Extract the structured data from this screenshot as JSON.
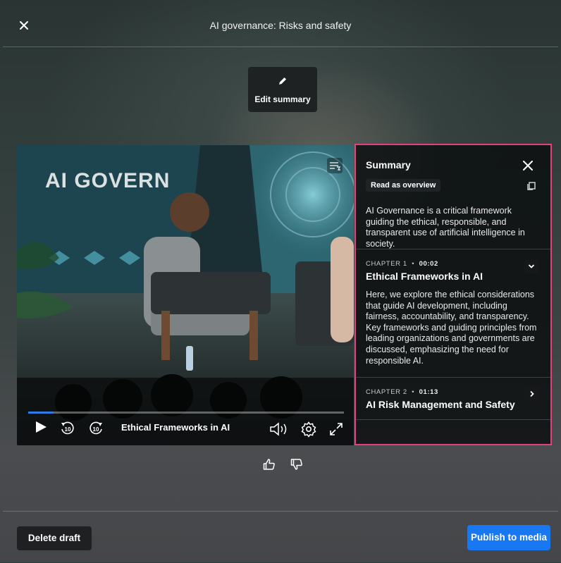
{
  "header": {
    "title": "AI governance: Risks and safety",
    "close_icon": "close-icon"
  },
  "edit_summary": {
    "label": "Edit summary",
    "icon": "pencil-icon"
  },
  "video": {
    "now_playing_chapter": "Ethical Frameworks in AI",
    "stage_sign_text": "AI GOVERN",
    "progress_fraction": 0.08,
    "controls": [
      "play-icon",
      "rewind-10-icon",
      "forward-10-icon",
      "volume-icon",
      "settings-gear-icon",
      "fullscreen-icon",
      "summary-toggle-icon"
    ]
  },
  "summary": {
    "heading": "Summary",
    "overview_badge": "Read as overview",
    "overview_text": "AI Governance is a critical framework guiding the ethical, responsible, and transparent use of artificial intelligence in society.",
    "chapters": [
      {
        "label": "CHAPTER 1",
        "time": "00:02",
        "title": "Ethical Frameworks in AI",
        "expanded": true,
        "body": "Here, we explore the ethical considerations that guide AI development, including fairness, accountability, and transparency. Key frameworks and guiding principles from leading organizations and governments are discussed, emphasizing the need for responsible AI."
      },
      {
        "label": "CHAPTER 2",
        "time": "01:13",
        "title": "AI Risk Management and Safety",
        "expanded": false
      }
    ],
    "accent_color": "#e43f7f"
  },
  "rating": {
    "like_icon": "thumbs-up-icon",
    "dislike_icon": "thumbs-down-icon"
  },
  "footer": {
    "delete_label": "Delete draft",
    "publish_label": "Publish to media",
    "publish_color": "#1778f2"
  }
}
